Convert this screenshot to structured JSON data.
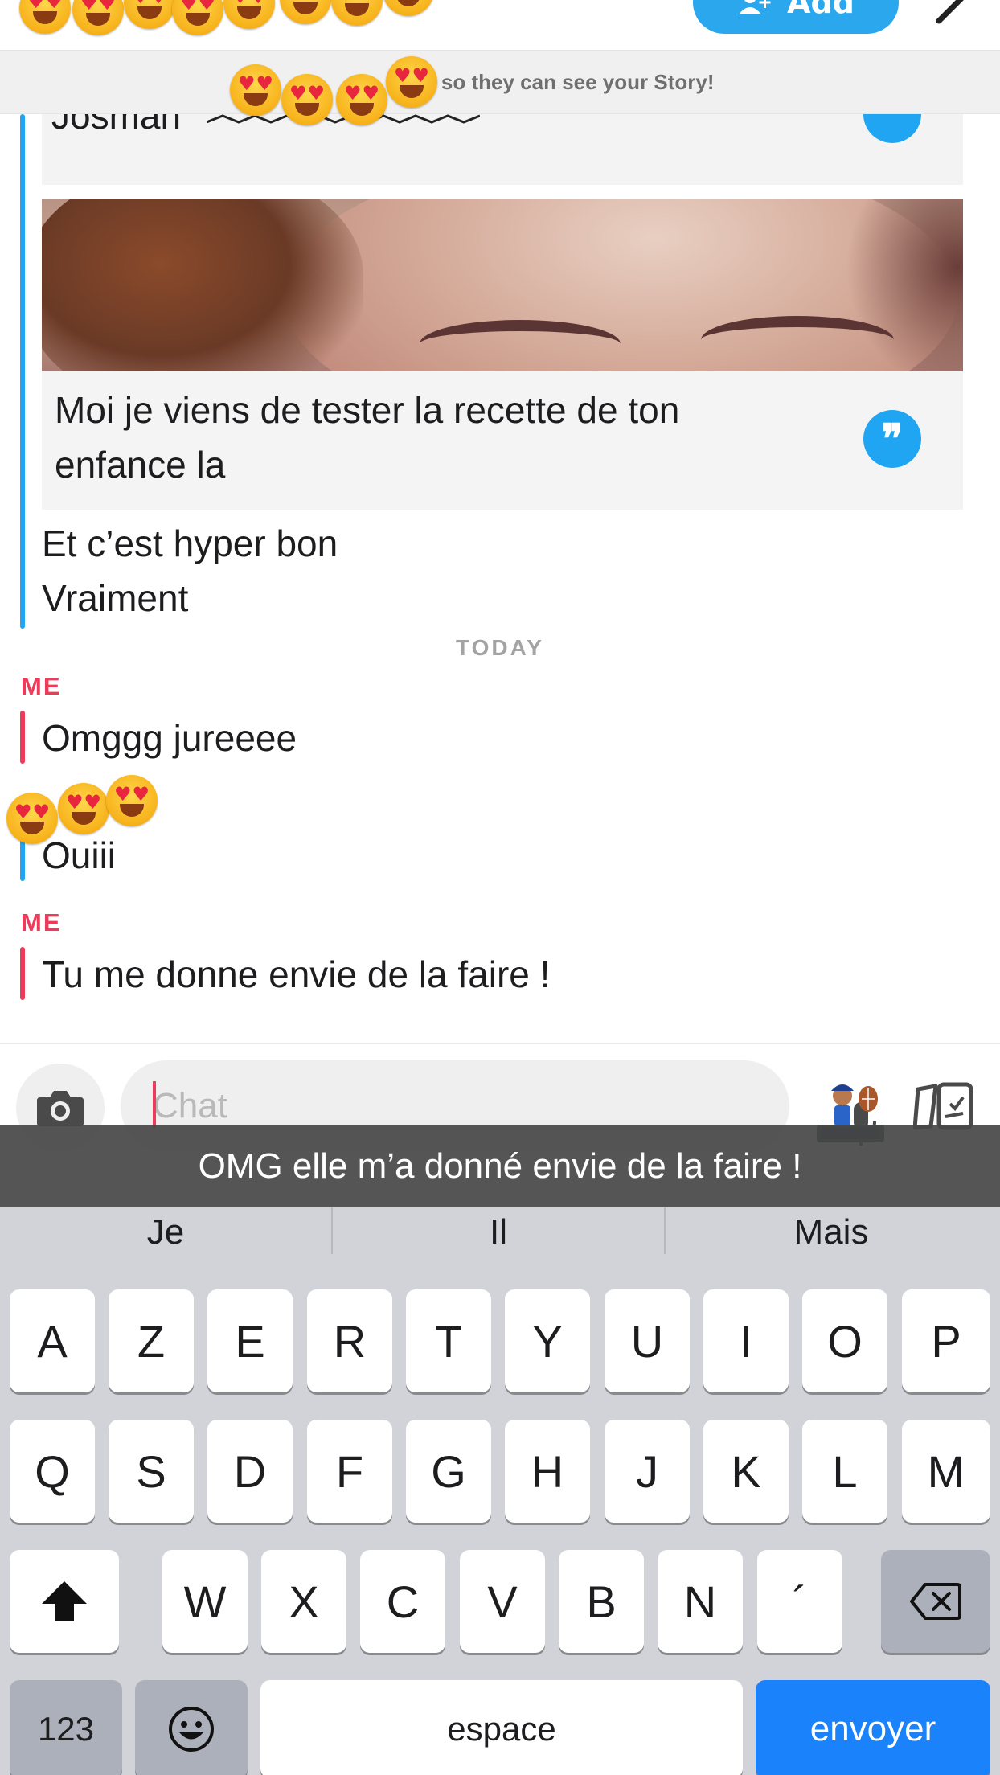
{
  "header": {
    "add_label": "Add"
  },
  "banner": {
    "text": "end so they can see your Story!"
  },
  "messages": {
    "partial_sender_name": "Josman",
    "quoted_caption": "Moi je viens de tester la recette de ton enfance la",
    "friend_line1": "Et c’est hyper bon",
    "friend_line2": "Vraiment",
    "date_divider": "TODAY",
    "me_label": "ME",
    "me_msg1": "Omggg jureeee",
    "friend_msg": "Ouiii",
    "me_msg2": "Tu me donne envie de la faire !"
  },
  "input": {
    "placeholder": "Chat"
  },
  "subtitle": {
    "text": "OMG elle m’a donné envie de la faire !"
  },
  "keyboard": {
    "suggestions": [
      "Je",
      "Il",
      "Mais"
    ],
    "row1": [
      "A",
      "Z",
      "E",
      "R",
      "T",
      "Y",
      "U",
      "I",
      "O",
      "P"
    ],
    "row2": [
      "Q",
      "S",
      "D",
      "F",
      "G",
      "H",
      "J",
      "K",
      "L",
      "M"
    ],
    "row3": [
      "W",
      "X",
      "C",
      "V",
      "B",
      "N",
      "´"
    ],
    "numbers_label": "123",
    "space_label": "espace",
    "send_label": "envoyer"
  },
  "colors": {
    "friend_accent": "#1fa5f1",
    "me_accent": "#ee3b5b",
    "send_key": "#1a82fb"
  },
  "icons": [
    "add-friend-icon",
    "edit-icon",
    "quote-icon",
    "camera-icon",
    "microphone-icon",
    "bitmoji-icon",
    "cards-icon",
    "shift-icon",
    "backspace-icon",
    "emoji-icon",
    "heart-eyes-emoji"
  ]
}
